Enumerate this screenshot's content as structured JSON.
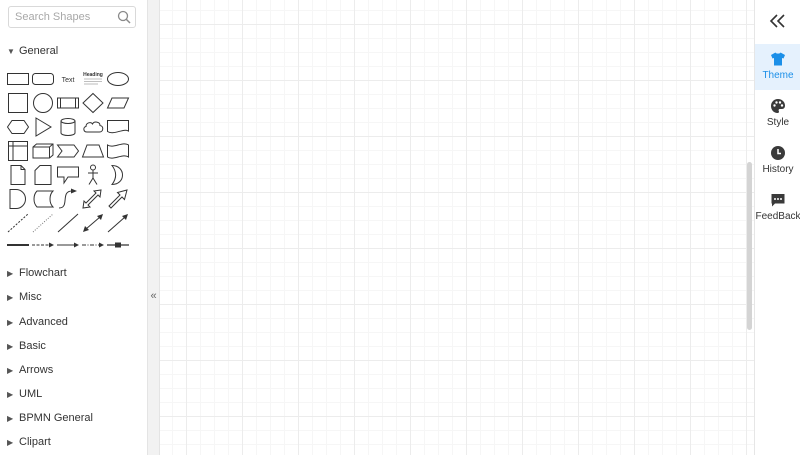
{
  "search": {
    "placeholder": "Search Shapes"
  },
  "sections": [
    {
      "label": "General",
      "expanded": true
    },
    {
      "label": "Flowchart",
      "expanded": false
    },
    {
      "label": "Misc",
      "expanded": false
    },
    {
      "label": "Advanced",
      "expanded": false
    },
    {
      "label": "Basic",
      "expanded": false
    },
    {
      "label": "Arrows",
      "expanded": false
    },
    {
      "label": "UML",
      "expanded": false
    },
    {
      "label": "BPMN General",
      "expanded": false
    },
    {
      "label": "Clipart",
      "expanded": false
    }
  ],
  "general_shapes": {
    "text_shape_label": "Text",
    "heading_shape_label": "Heading"
  },
  "left_collapse_glyph": "«",
  "right_panel": {
    "collapse_icon": "double-chevron-left-icon",
    "items": [
      {
        "label": "Theme",
        "icon": "tshirt-icon",
        "active": true
      },
      {
        "label": "Style",
        "icon": "palette-icon",
        "active": false
      },
      {
        "label": "History",
        "icon": "clock-icon",
        "active": false
      },
      {
        "label": "FeedBack",
        "icon": "feedback-icon",
        "active": false
      }
    ]
  },
  "colors": {
    "accent": "#1b8fe8",
    "active_bg": "#e5f1fd",
    "grid": "#ececec"
  }
}
